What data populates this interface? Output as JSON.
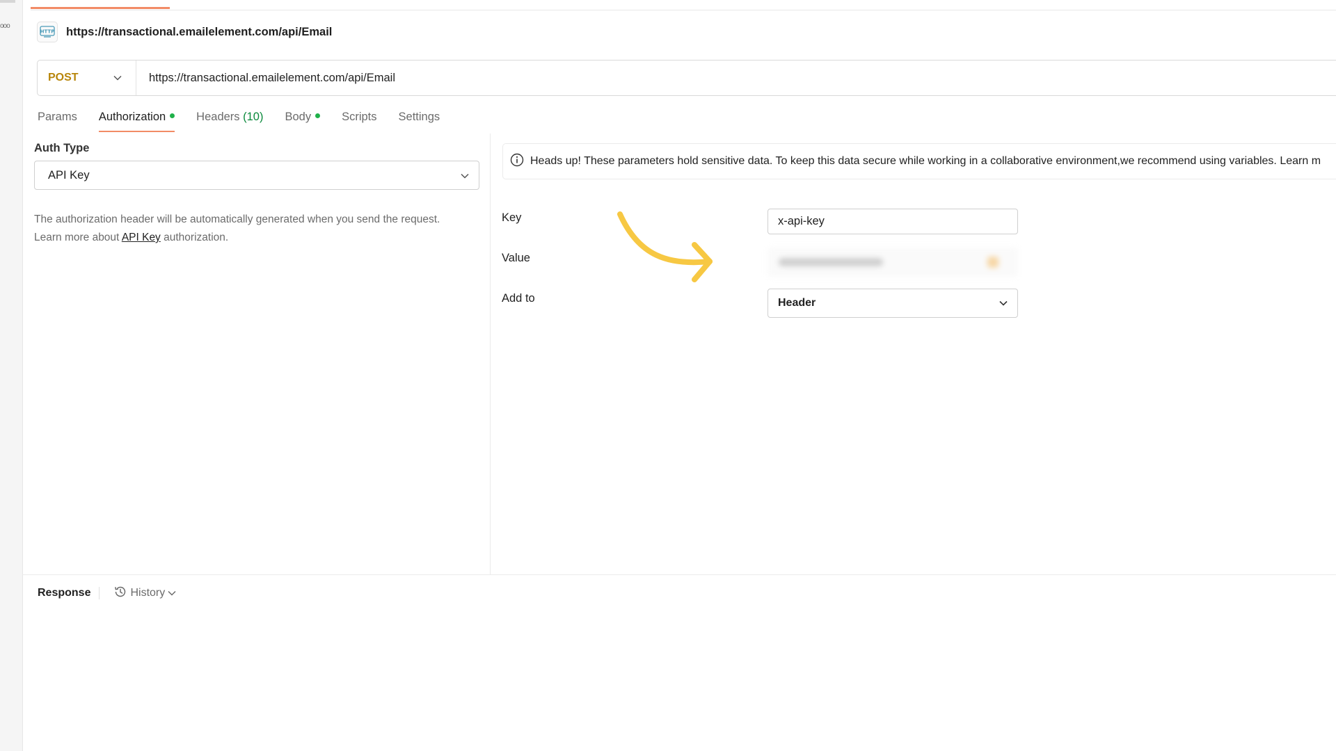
{
  "request": {
    "title": "https://transactional.emailelement.com/api/Email",
    "method": "POST",
    "url": "https://transactional.emailelement.com/api/Email"
  },
  "tabs": {
    "params": "Params",
    "authorization": "Authorization",
    "headers": "Headers",
    "headers_count": "(10)",
    "body": "Body",
    "scripts": "Scripts",
    "settings": "Settings"
  },
  "auth": {
    "type_label": "Auth Type",
    "type_value": "API Key",
    "desc_line1": "The authorization header will be automatically generated when you send the request.",
    "desc_line2_prefix": "Learn more about ",
    "desc_link": "API Key",
    "desc_line2_suffix": " authorization."
  },
  "banner": {
    "text": "Heads up! These parameters hold sensitive data. To keep this data secure while working in a collaborative environment,we recommend using variables. Learn m"
  },
  "fields": {
    "key_label": "Key",
    "key_value": "x-api-key",
    "value_label": "Value",
    "addto_label": "Add to",
    "addto_value": "Header"
  },
  "response": {
    "label": "Response",
    "history": "History"
  },
  "colors": {
    "accent": "#f28b66",
    "method": "#b8860b",
    "status_dot": "#20b14a",
    "annotation_arrow": "#f7c843"
  }
}
